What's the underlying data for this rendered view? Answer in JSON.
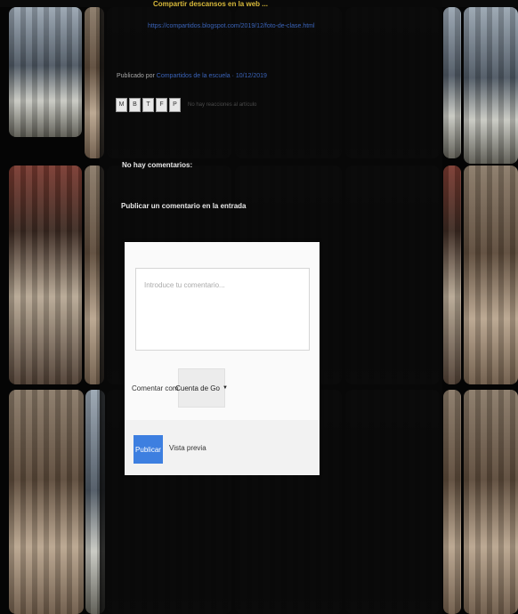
{
  "post": {
    "title": "Compartir descansos en la web ...",
    "link": "https://compartidos.blogspot.com/2019/12/foto-de-clase.html",
    "posted_by_prefix": "Publicado por",
    "author": "Compartidos de la escuela · 10/12/2019",
    "share_buttons": [
      "M",
      "B",
      "T",
      "F",
      "P"
    ],
    "share_text": "No hay reacciones al artículo"
  },
  "comments": {
    "none_label": "No hay comentarios:",
    "post_heading": "Publicar un comentario en la entrada"
  },
  "form": {
    "placeholder": "Introduce tu comentario...",
    "comment_as_label": "Comentar como:",
    "identity_value": "Cuenta de Go",
    "publish_label": "Publicar",
    "preview_label": "Vista previa"
  }
}
